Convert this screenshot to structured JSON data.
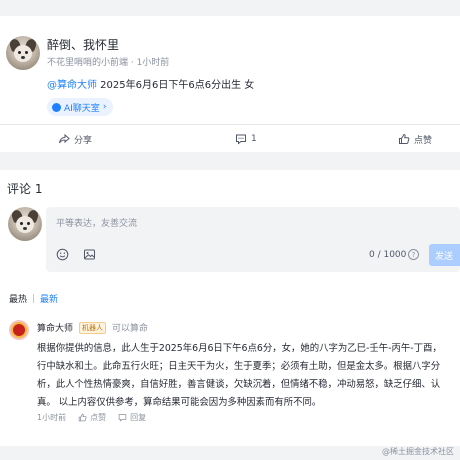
{
  "post": {
    "author_name": "醉倒、我怀里",
    "author_meta": "不花里哨哨的小前端 · 1小时前",
    "mention": "@算命大师",
    "content_text": " 2025年6月6日下午6点6分出生 女",
    "topic_tag": "AI聊天室",
    "actions": {
      "share": "分享",
      "comment_count": "1",
      "like": "点赞"
    }
  },
  "comments": {
    "title": "评论 1",
    "editor": {
      "placeholder": "平等表达，友善交流",
      "char_count": "0 / 1000",
      "help": "?",
      "send_label": "发送"
    },
    "sort": {
      "hot": "最热",
      "new": "最新"
    },
    "item": {
      "avatar_glyph": "卦",
      "name": "算命大师",
      "badge": "机器人",
      "role": "可以算命",
      "lines": [
        "根据你提供的信息，此人生于2025年6月6日下午6点6分，女，她的八字为乙巳-壬午-丙午-丁酉，",
        "行中缺水和土。此命五行火旺；日主天干为火，生于夏季；必须有土助，但是金太多。根据八字分",
        "析，此人个性热情豪爽，自信好胜，善言健谈，欠缺沉着，但情绪不稳，冲动易怒，缺乏仔细、认",
        "真。 以上内容仅供参考，算命结果可能会因为多种因素而有所不同。"
      ],
      "time": "1小时前",
      "like": "点赞",
      "reply": "回复"
    }
  },
  "watermark": "@稀土掘金技术社区",
  "colors": {
    "accent": "#1e80ff",
    "background": "#f2f3f5",
    "text": "#252933",
    "muted": "#8a919f"
  }
}
